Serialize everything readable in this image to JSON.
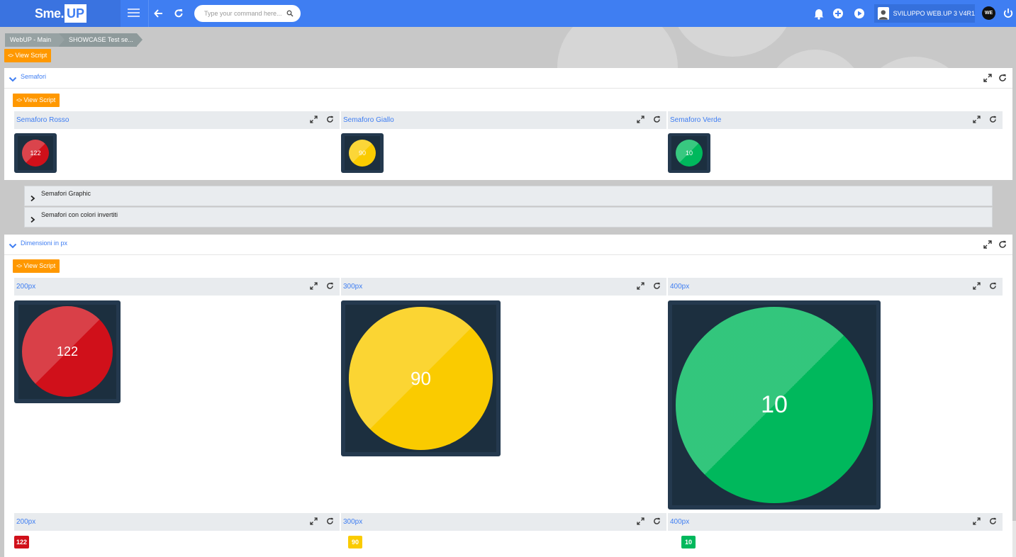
{
  "topbar": {
    "logo_left": "Sme.",
    "logo_right": "UP",
    "search_placeholder": "Type your command here...",
    "user_name": "SVILUPPO WEB.UP 3 V4R1",
    "avatar_initials": "WE"
  },
  "breadcrumb": {
    "items": [
      "WebUP - Main",
      "SHOWCASE Test se..."
    ]
  },
  "view_script_label": "View Script",
  "semafori_panel": {
    "title": "Semafori",
    "subs": [
      {
        "title": "Semaforo Rosso",
        "value": "122",
        "color": "#d0101a"
      },
      {
        "title": "Semaforo Giallo",
        "value": "90",
        "color": "#facb00"
      },
      {
        "title": "Semaforo Verde",
        "value": "10",
        "color": "#00b85c"
      }
    ]
  },
  "collapsed_sections": [
    "Semafori Graphic",
    "Semafori con colori invertiti"
  ],
  "dimensioni_panel": {
    "title": "Dimensioni in px",
    "subs": [
      {
        "title": "200px",
        "value": "122",
        "color": "#d0101a"
      },
      {
        "title": "300px",
        "value": "90",
        "color": "#facb00"
      },
      {
        "title": "400px",
        "value": "10",
        "color": "#00b85c"
      }
    ],
    "badge_subs": [
      {
        "title": "200px",
        "value": "122",
        "color": "#d0101a"
      },
      {
        "title": "300px",
        "value": "90",
        "color": "#facb00"
      },
      {
        "title": "400px",
        "value": "10",
        "color": "#00b85c"
      }
    ]
  },
  "icons": {
    "menu": "hamburger-icon",
    "back": "back-arrow-icon",
    "refresh": "refresh-icon",
    "search": "search-icon",
    "bell": "bell-icon",
    "add": "plus-circle-icon",
    "play": "play-circle-icon",
    "power": "power-icon",
    "expand": "expand-icon",
    "collapse": "chevron-down-icon",
    "expand_section": "chevron-right-icon"
  }
}
